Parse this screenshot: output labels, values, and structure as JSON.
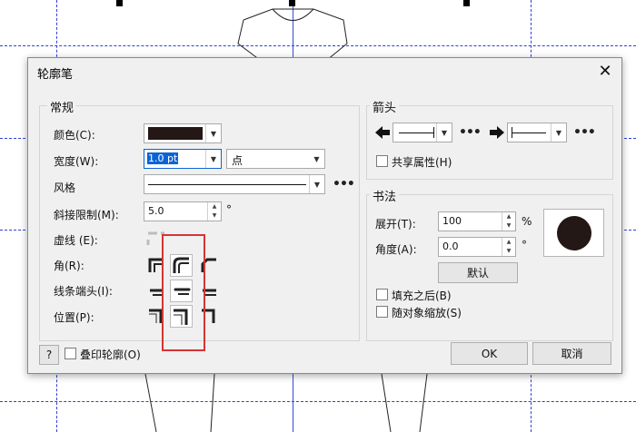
{
  "dialog": {
    "title": "轮廓笔",
    "close_glyph": "✕",
    "general": {
      "title": "常规",
      "color_label": "颜色(C):",
      "color_value": "#231815",
      "width_label": "宽度(W):",
      "width_value": "1.0 pt",
      "unit_value": "点",
      "style_label": "风格",
      "miter_label": "斜接限制(M):",
      "miter_value": "5.0",
      "miter_unit": "°",
      "dash_label": "虚线 (E):",
      "corner_label": "角(R):",
      "linecap_label": "线条端头(I):",
      "position_label": "位置(P):",
      "more_glyph": "•••"
    },
    "arrows": {
      "title": "箭头",
      "share_label": "共享属性(H)",
      "more_glyph": "•••"
    },
    "calligraphy": {
      "title": "书法",
      "stretch_label": "展开(T):",
      "stretch_value": "100",
      "stretch_unit": "%",
      "angle_label": "角度(A):",
      "angle_value": "0.0",
      "angle_unit": "°",
      "default_button": "默认",
      "fill_behind_label": "填充之后(B)",
      "scale_label": "随对象缩放(S)",
      "nib_color": "#231815"
    },
    "footer": {
      "help_label": "?",
      "overprint_label": "叠印轮廓(O)",
      "ok_label": "OK",
      "cancel_label": "取消"
    }
  },
  "colors": {
    "guide": "#2f3fd8",
    "highlight": "#d63434",
    "selection": "#0a64d8"
  }
}
